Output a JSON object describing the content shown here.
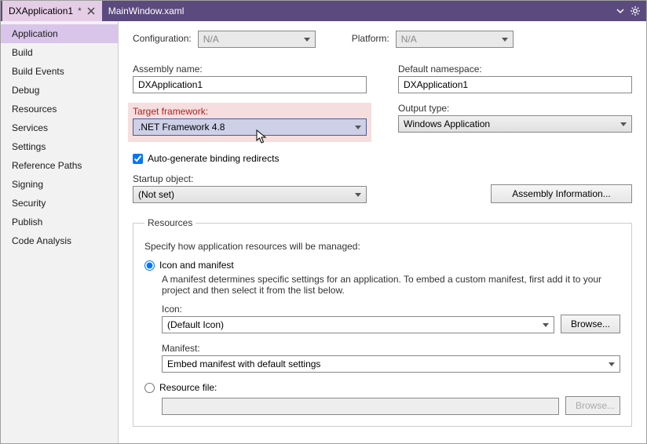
{
  "tabs": {
    "active": "DXApplication1",
    "dirty": "*",
    "inactive": "MainWindow.xaml"
  },
  "sidebar": {
    "items": [
      "Application",
      "Build",
      "Build Events",
      "Debug",
      "Resources",
      "Services",
      "Settings",
      "Reference Paths",
      "Signing",
      "Security",
      "Publish",
      "Code Analysis"
    ]
  },
  "configRow": {
    "configLabel": "Configuration:",
    "configValue": "N/A",
    "platformLabel": "Platform:",
    "platformValue": "N/A"
  },
  "assembly": {
    "label": "Assembly name:",
    "value": "DXApplication1"
  },
  "namespace": {
    "label": "Default namespace:",
    "value": "DXApplication1"
  },
  "framework": {
    "label": "Target framework:",
    "value": ".NET Framework 4.8"
  },
  "output": {
    "label": "Output type:",
    "value": "Windows Application"
  },
  "autogen": {
    "label": "Auto-generate binding redirects"
  },
  "startup": {
    "label": "Startup object:",
    "value": "(Not set)"
  },
  "asmInfoBtn": "Assembly Information...",
  "resources": {
    "legend": "Resources",
    "desc": "Specify how application resources will be managed:",
    "iconManifest": "Icon and manifest",
    "subDesc": "A manifest determines specific settings for an application. To embed a custom manifest, first add it to your project and then select it from the list below.",
    "iconLabel": "Icon:",
    "iconValue": "(Default Icon)",
    "browse": "Browse...",
    "manifestLabel": "Manifest:",
    "manifestValue": "Embed manifest with default settings",
    "resFile": "Resource file:"
  }
}
